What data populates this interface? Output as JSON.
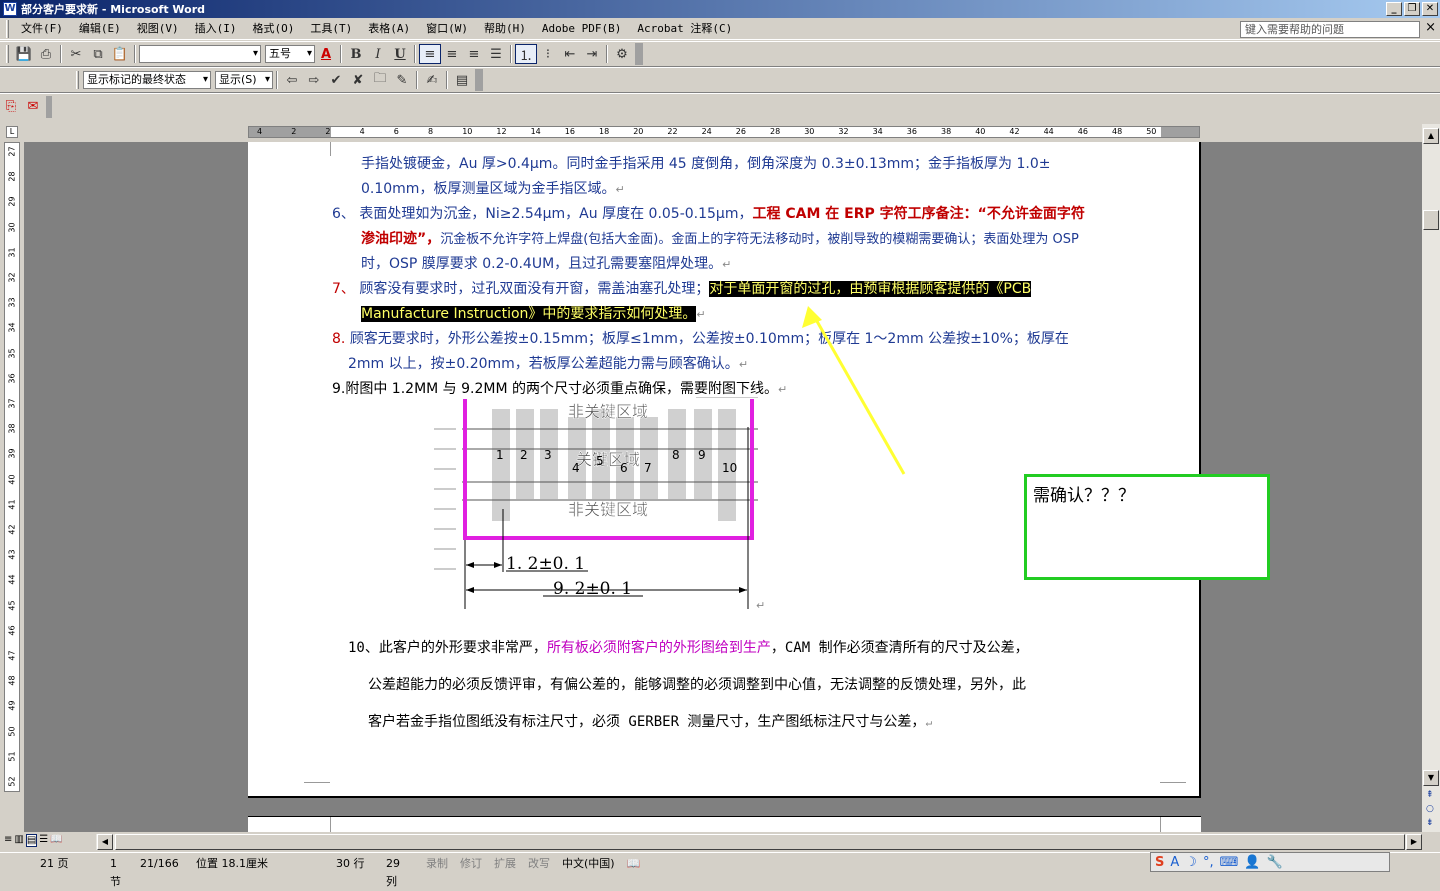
{
  "window": {
    "title": "部分客户要求新 - Microsoft Word",
    "title_icon": "W",
    "buttons": {
      "minimize": "_",
      "restore": "❐",
      "close": "✕"
    }
  },
  "menu": {
    "items": [
      "文件(F)",
      "编辑(E)",
      "视图(V)",
      "插入(I)",
      "格式(O)",
      "工具(T)",
      "表格(A)",
      "窗口(W)",
      "帮助(H)",
      "Adobe PDF(B)",
      "Acrobat 注释(C)"
    ],
    "help_placeholder": "键入需要帮助的问题",
    "close": "×"
  },
  "toolbar1": {
    "font_name": "",
    "font_size": "五号",
    "bold": "B",
    "italic": "I",
    "underline": "U",
    "font_color": "A"
  },
  "toolbar2": {
    "markup_view": "显示标记的最终状态",
    "show_menu": "显示(S)"
  },
  "ruler": {
    "h_labels": [
      "4",
      "2",
      "2",
      "4",
      "6",
      "8",
      "10",
      "12",
      "14",
      "16",
      "18",
      "20",
      "22",
      "24",
      "26",
      "28",
      "30",
      "32",
      "34",
      "36",
      "38",
      "40",
      "42",
      "44",
      "46",
      "48",
      "50"
    ],
    "v_labels": [
      "27",
      "28",
      "29",
      "30",
      "31",
      "32",
      "33",
      "34",
      "35",
      "36",
      "37",
      "38",
      "39",
      "40",
      "41",
      "42",
      "43",
      "44",
      "45",
      "46",
      "47",
      "48",
      "49",
      "50",
      "51",
      "52"
    ],
    "corner": "L"
  },
  "document": {
    "p5_line0": "手指处镀硬金，Au 厚>0.4μm。同时金手指采用 45 度倒角，倒角深度为 0.3±0.13mm；金手指板厚为 1.0±",
    "p5_line1": "0.10mm，板厚测量区域为金手指区域。",
    "p6_num": "6、",
    "p6_a": "表面处理如为沉金，Ni≥2.54μm，Au 厚度在 0.05-0.15μm，",
    "p6_b": "工程 CAM 在 ERP 字符工序备注：“不允许金面字符",
    "p6_c": "渗油印迹”，",
    "p6_d": "沉金板不允许字符上焊盘(包括大金面)。金面上的字符无法移动时，被削导致的模糊需要确认；表面处理为 OSP",
    "p6_e": "时，OSP 膜厚要求 0.2-0.4UM，且过孔需要塞阻焊处理。",
    "p7_num": "7、",
    "p7_a": "顾客没有要求时，过孔双面没有开窗，需盖油塞孔处理；",
    "p7_b": "对于单面开窗的过孔，由预审根据顾客提供的《PCB",
    "p7_c": "Manufacture Instruction》中的要求指示如何处理。",
    "p8_num": "8.",
    "p8_a": "顾客无要求时，外形公差按±0.15mm；板厚≤1mm，公差按±0.10mm；板厚在 1～2mm 公差按±10%；板厚在",
    "p8_b": "2mm 以上，按±0.20mm，若板厚公差超能力需与顾客确认。",
    "p9": "9.附图中 1.2MM 与 9.2MM 的两个尺寸必须重点确保，需要附图下线。",
    "p10_a": "10、此客户的外形要求非常严，",
    "p10_b": "所有板必须附客户的外形图给到生产",
    "p10_c": "，CAM 制作必须查清所有的尺寸及公差，",
    "p10_d": "公差超能力的必须反馈评审，有偏公差的，能够调整的必须调整到中心值，无法调整的反馈处理，另外，此",
    "p10_e": "客户若金手指位图纸没有标注尺寸，必须 GERBER 测量尺寸，生产图纸标注尺寸与公差，",
    "para_mark": "↵"
  },
  "diagram": {
    "zone_top": "非关键区域",
    "zone_mid": "关键区域",
    "zone_bottom": "非关键区域",
    "fingers": [
      "1",
      "2",
      "3",
      "4",
      "5",
      "6",
      "7",
      "8",
      "9",
      "10"
    ],
    "dim1": "1. 2±0. 1",
    "dim2": "9. 2±0. 1"
  },
  "callout": {
    "text": "需确认？？？"
  },
  "statusbar": {
    "page": "21 页",
    "section": "1 节",
    "of": "21/166",
    "position": "位置 18.1厘米",
    "line": "30 行",
    "col": "29 列",
    "rec": "录制",
    "trk": "修订",
    "ext": "扩展",
    "ovr": "改写",
    "lang": "中文(中国)"
  },
  "colors": {
    "accent": "#0a246a",
    "callout_border": "#22cc22",
    "arrow": "#ffff33",
    "magenta": "#e020e0"
  }
}
